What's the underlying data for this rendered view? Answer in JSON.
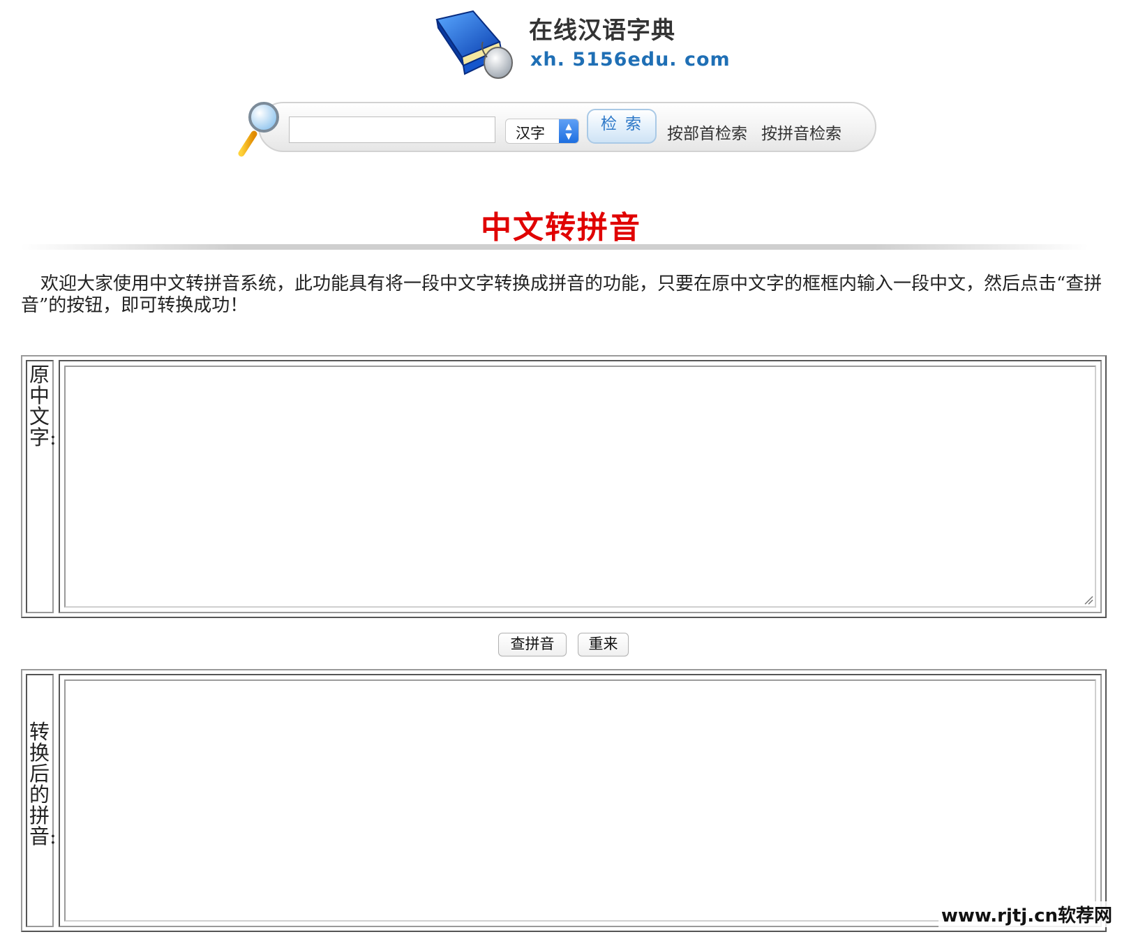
{
  "logo": {
    "title": "在线汉语字典",
    "url": "xh. 5156edu. com"
  },
  "search": {
    "input_value": "",
    "select_value": "汉字",
    "button_label": "检索",
    "link_radical": "按部首检索",
    "link_pinyin": "按拼音检索"
  },
  "page": {
    "title": "中文转拼音",
    "intro": "欢迎大家使用中文转拼音系统，此功能具有将一段中文字转换成拼音的功能，只要在原中文字的框框内输入一段中文，然后点击“查拼音”的按钮，即可转换成功！"
  },
  "source_panel": {
    "label": "原中文字:",
    "value": ""
  },
  "actions": {
    "convert_label": "查拼音",
    "reset_label": "重来"
  },
  "result_panel": {
    "label": "转换后的拼音:",
    "value": ""
  },
  "watermark": "www.rjtj.cn软荐网",
  "colors": {
    "title_red": "#e00000",
    "link_blue": "#1f6fb5",
    "search_button_text": "#2d78c8"
  }
}
